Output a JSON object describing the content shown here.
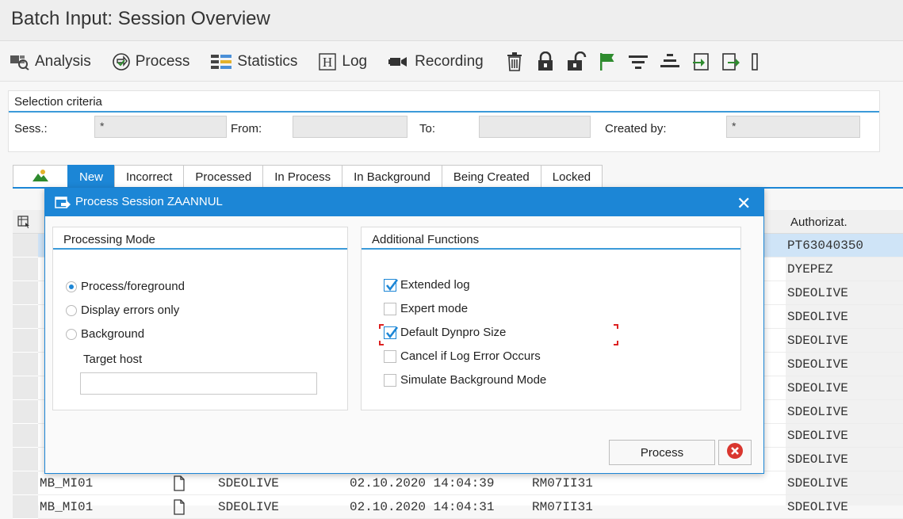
{
  "window": {
    "title": "Batch Input: Session Overview"
  },
  "toolbar": {
    "analysis": "Analysis",
    "process": "Process",
    "statistics": "Statistics",
    "log": "Log",
    "recording": "Recording"
  },
  "selection": {
    "title": "Selection criteria",
    "sess_label": "Sess.:",
    "sess_value": "*",
    "from_label": "From:",
    "from_value": "",
    "to_label": "To:",
    "to_value": "",
    "created_by_label": "Created by:",
    "created_by_value": "*"
  },
  "tabs": [
    "New",
    "Incorrect",
    "Processed",
    "In Process",
    "In Background",
    "Being Created",
    "Locked"
  ],
  "grid": {
    "col_authorizat": "Authorizat.",
    "rows": [
      {
        "c0": "",
        "c1": "",
        "c2": "",
        "c3": "",
        "c4": "",
        "auth": "PT63040350"
      },
      {
        "c0": "",
        "c1": "",
        "c2": "",
        "c3": "",
        "c4": "",
        "auth": "DYEPEZ"
      },
      {
        "c0": "",
        "c1": "",
        "c2": "",
        "c3": "",
        "c4": "",
        "auth": "SDEOLIVE"
      },
      {
        "c0": "",
        "c1": "",
        "c2": "",
        "c3": "",
        "c4": "",
        "auth": "SDEOLIVE"
      },
      {
        "c0": "",
        "c1": "",
        "c2": "",
        "c3": "",
        "c4": "",
        "auth": "SDEOLIVE"
      },
      {
        "c0": "",
        "c1": "",
        "c2": "",
        "c3": "",
        "c4": "",
        "auth": "SDEOLIVE"
      },
      {
        "c0": "",
        "c1": "",
        "c2": "",
        "c3": "",
        "c4": "",
        "auth": "SDEOLIVE"
      },
      {
        "c0": "",
        "c1": "",
        "c2": "",
        "c3": "",
        "c4": "",
        "auth": "SDEOLIVE"
      },
      {
        "c0": "",
        "c1": "",
        "c2": "",
        "c3": "",
        "c4": "",
        "auth": "SDEOLIVE"
      },
      {
        "c0": "",
        "c1": "",
        "c2": "",
        "c3": "",
        "c4": "",
        "auth": "SDEOLIVE"
      },
      {
        "c0": "MB_MI01",
        "c1": "",
        "c2": "SDEOLIVE",
        "c3": "02.10.2020 14:04:39",
        "c4": "RM07II31",
        "auth": "SDEOLIVE"
      },
      {
        "c0": "MB_MI01",
        "c1": "",
        "c2": "SDEOLIVE",
        "c3": "02.10.2020 14:04:31",
        "c4": "RM07II31",
        "auth": "SDEOLIVE"
      }
    ]
  },
  "dialog": {
    "title": "Process Session ZAANNUL",
    "processing_mode": {
      "title": "Processing Mode",
      "options": [
        "Process/foreground",
        "Display errors only",
        "Background"
      ],
      "selected": "Process/foreground",
      "target_host_label": "Target host",
      "target_host_value": ""
    },
    "additional": {
      "title": "Additional Functions",
      "options": [
        {
          "label": "Extended log",
          "checked": true
        },
        {
          "label": "Expert mode",
          "checked": false
        },
        {
          "label": "Default Dynpro Size",
          "checked": true
        },
        {
          "label": "Cancel if Log Error Occurs",
          "checked": false
        },
        {
          "label": "Simulate Background Mode",
          "checked": false
        }
      ]
    },
    "process_button": "Process"
  },
  "colors": {
    "accent": "#1c86d6",
    "selected_row": "#cfe4f7",
    "cancel": "#d9362e",
    "flag": "#2e8b2e"
  }
}
